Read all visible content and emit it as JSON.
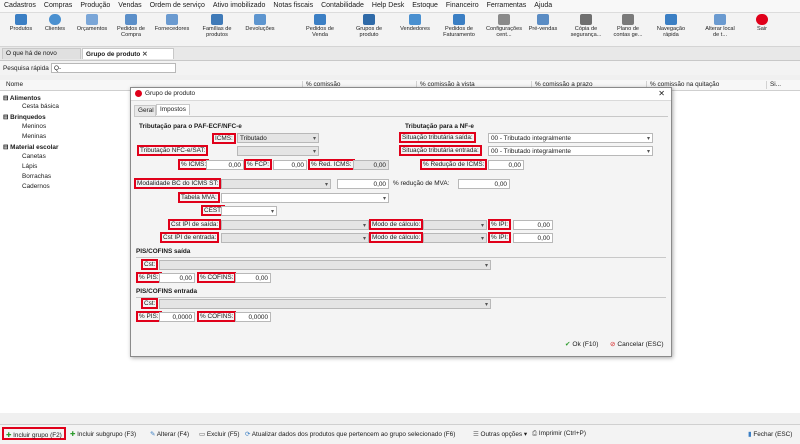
{
  "menu": [
    "Cadastros",
    "Compras",
    "Produção",
    "Vendas",
    "Ordem de serviço",
    "Ativo imobilizado",
    "Notas fiscais",
    "Contabilidade",
    "Help Desk",
    "Estoque",
    "Financeiro",
    "Ferramentas",
    "Ajuda"
  ],
  "toolbar": [
    {
      "label1": "Produtos",
      "label2": ""
    },
    {
      "label1": "Clientes",
      "label2": ""
    },
    {
      "label1": "Orçamentos",
      "label2": ""
    },
    {
      "label1": "Pedidos de",
      "label2": "Compra"
    },
    {
      "label1": "Fornecedores",
      "label2": ""
    },
    {
      "label1": "Famílias de",
      "label2": "produtos"
    },
    {
      "label1": "Devoluções",
      "label2": ""
    },
    {
      "label1": "Pedidos de",
      "label2": "Venda"
    },
    {
      "label1": "Grupos de",
      "label2": "produto"
    },
    {
      "label1": "Vendedores",
      "label2": ""
    },
    {
      "label1": "Pedidos de",
      "label2": "Faturamento"
    },
    {
      "label1": "Configurações",
      "label2": "cent..."
    },
    {
      "label1": "Pré-vendas",
      "label2": ""
    },
    {
      "label1": "Cópia de",
      "label2": "segurança..."
    },
    {
      "label1": "Plano de",
      "label2": "contas ge..."
    },
    {
      "label1": "Navegação",
      "label2": "rápida"
    },
    {
      "label1": "Alterar local",
      "label2": "de t..."
    },
    {
      "label1": "Sair",
      "label2": ""
    }
  ],
  "tabs": {
    "tab1": "O que há de novo",
    "tab2": "Grupo de produto"
  },
  "quick_search": {
    "label": "Pesquisa rápida",
    "placeholder": "Q-"
  },
  "grid": {
    "headers": [
      "Nome",
      "% comissão",
      "% comissão à vista",
      "% comissão a prazo",
      "% comissão na quitação",
      "Si..."
    ],
    "rows": [
      {
        "text": "Alimentos",
        "level": 0
      },
      {
        "text": "Cesta básica",
        "level": 1
      },
      {
        "text": "Brinquedos",
        "level": 0
      },
      {
        "text": "Meninos",
        "level": 1
      },
      {
        "text": "Meninas",
        "level": 1
      },
      {
        "text": "Material escolar",
        "level": 0
      },
      {
        "text": "Canetas",
        "level": 1
      },
      {
        "text": "Lápis",
        "level": 1
      },
      {
        "text": "Borrachas",
        "level": 1
      },
      {
        "text": "Cadernos",
        "level": 1
      }
    ]
  },
  "dialog": {
    "title": "Grupo de produto",
    "tabs": {
      "geral": "Geral",
      "impostos": "Impostos"
    },
    "paf": {
      "section": "Tributação para o PAF-ECF/NFC-e",
      "icms_label": "ICMS:",
      "icms_value": "Tributado",
      "nfce_label": "Tributação NFC-e/SAT:",
      "nfce_value": "",
      "picms_label": "% ICMS:",
      "picms_value": "0,00",
      "fcp_label": "% FCP:",
      "fcp_value": "0,00",
      "redicms_label": "% Red. ICMS:",
      "redicms_value": "0,00"
    },
    "nfe": {
      "section": "Tributação para a NF-e",
      "saida_label": "Situação tributária saída:",
      "saida_value": "00 - Tributado integralmente",
      "entrada_label": "Situação tributária entrada:",
      "entrada_value": "00 - Tributado integralmente",
      "reducao_label": "% Redução de ICMS:",
      "reducao_value": "0,00"
    },
    "st": {
      "modalidade_label": "Modalidade BC do ICMS ST:",
      "modalidade_value": "",
      "mva_value": "0,00",
      "reducao_mva_label": "% redução de MVA:",
      "reducao_mva_value": "0,00",
      "tabela_label": "Tabela MVA:",
      "cest_label": "CEST:"
    },
    "ipi": {
      "saida_label": "Cst IPI de saída:",
      "entrada_label": "Cst IPI de entrada:",
      "modo1_label": "Modo de cálculo:",
      "modo2_label": "Modo de cálculo:",
      "pipi1_label": "% IPI:",
      "pipi1_value": "0,00",
      "pipi2_label": "% IPI:",
      "pipi2_value": "0,00"
    },
    "pis_saida": {
      "section": "PIS/COFINS saída",
      "cst_label": "Cst:",
      "pis_label": "% PIS:",
      "pis_value": "0,00",
      "cofins_label": "% COFINS:",
      "cofins_value": "0,00"
    },
    "pis_entrada": {
      "section": "PIS/COFINS entrada",
      "cst_label": "Cst:",
      "pis_label": "% PIS:",
      "pis_value": "0,0000",
      "cofins_label": "% COFINS:",
      "cofins_value": "0,0000"
    },
    "ok_label": "Ok (F10)",
    "cancel_label": "Cancelar (ESC)"
  },
  "bottom": {
    "incluir": "Incluir grupo (F2)",
    "subgrupo": "Incluir subgrupo  (F3)",
    "alterar": "Alterar (F4)",
    "excluir": "Excluir (F5)",
    "atualizar": "Atualizar dados dos produtos que pertencem ao grupo selecionado (F6)",
    "outras": "Outras opções",
    "imprimir": "Imprimir (Ctrl+P)",
    "fechar": "Fechar (ESC)"
  },
  "colors": {
    "accent": "#e0001a",
    "ok_green": "#2e9b2e",
    "cancel_red": "#d42020"
  }
}
